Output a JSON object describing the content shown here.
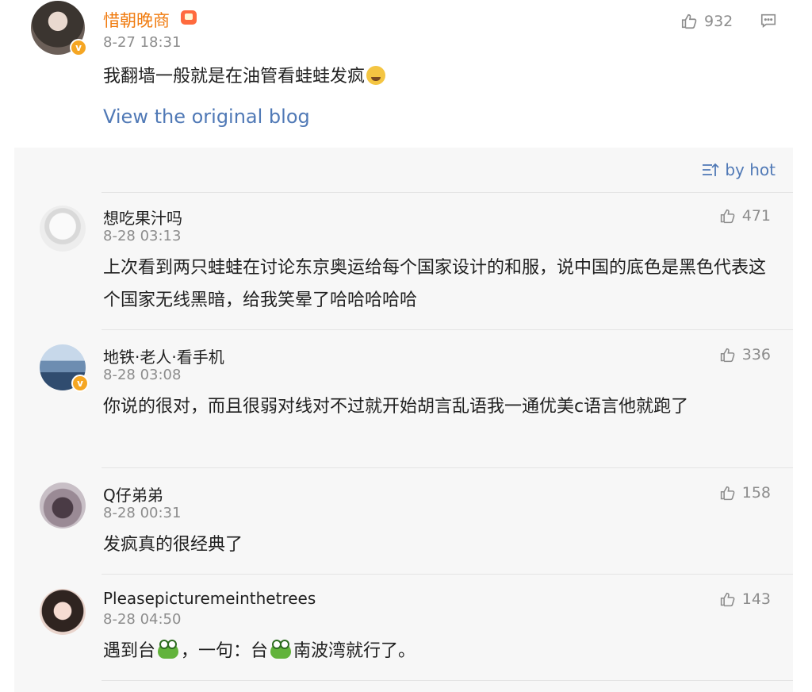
{
  "post": {
    "author": "惜朝晚商",
    "time": "8-27 18:31",
    "likes": "932",
    "text": "我翻墙一般就是在油管看蛙蛙发疯",
    "link": "View the original blog"
  },
  "sort": {
    "label": "by hot"
  },
  "comments": [
    {
      "name": "想吃果汁吗",
      "time": "8-28 03:13",
      "likes": "471",
      "text": "上次看到两只蛙蛙在讨论东京奥运给每个国家设计的和服，说中国的底色是黑色代表这个国家无线黑暗，给我笑晕了哈哈哈哈哈"
    },
    {
      "name": "地铁·老人·看手机",
      "time": "8-28 03:08",
      "likes": "336",
      "text": "你说的很对，而且很弱对线对不过就开始胡言乱语我一通优美c语言他就跑了"
    },
    {
      "name": "Q仔弟弟",
      "time": "8-28 00:31",
      "likes": "158",
      "text": "发疯真的很经典了"
    },
    {
      "name": "Pleasepicturemeinthetrees",
      "time": "8-28 04:50",
      "likes": "143",
      "text_a": "遇到台",
      "text_b": "，一句：台",
      "text_c": "南波湾就行了。"
    }
  ],
  "colors": {
    "link": "#5079b6",
    "author": "#f07b0f",
    "muted": "#8c8c8c"
  }
}
